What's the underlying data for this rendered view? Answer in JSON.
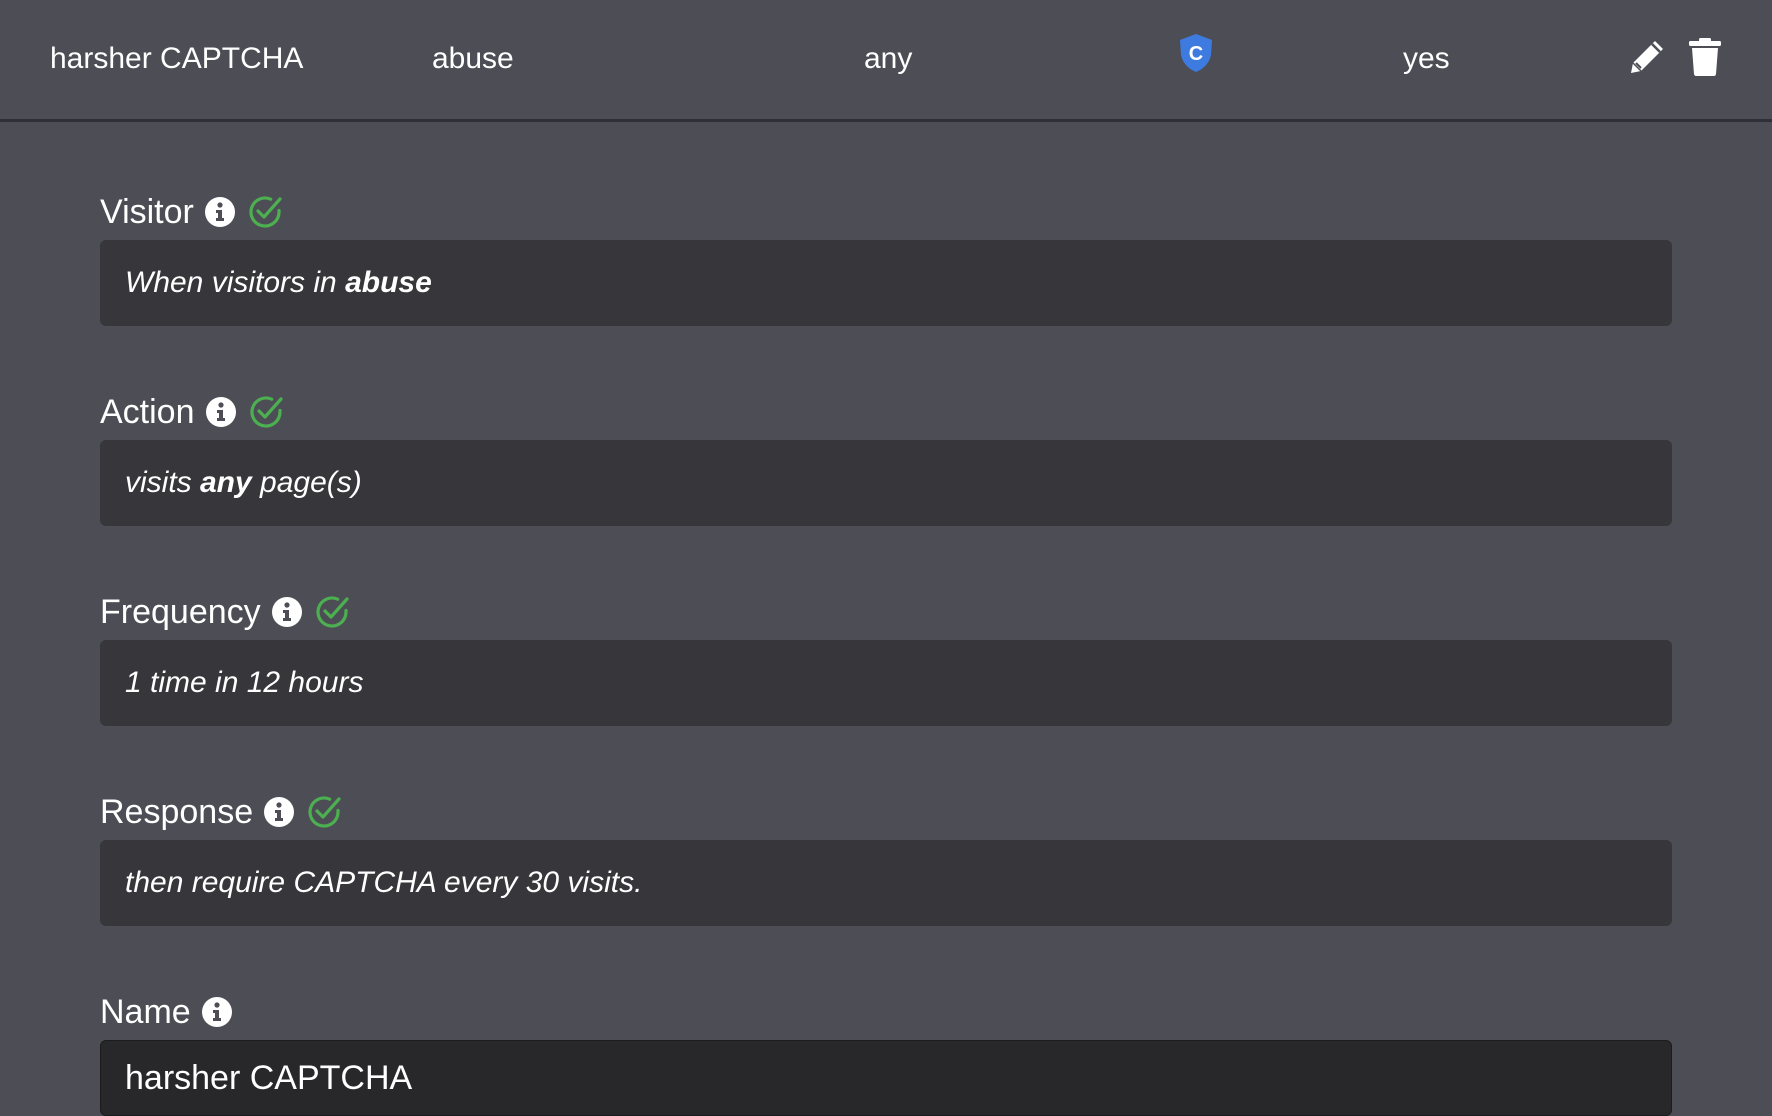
{
  "rule_row": {
    "name": "harsher CAPTCHA",
    "visitor": "abuse",
    "action": "any",
    "response_icon": "captcha-shield-icon",
    "enabled": "yes",
    "edit_icon": "pencil-icon",
    "delete_icon": "trash-icon"
  },
  "fields": {
    "visitor": {
      "label": "Visitor",
      "text_prefix": "When visitors in ",
      "text_bold": "abuse"
    },
    "action": {
      "label": "Action",
      "text_prefix": "visits ",
      "text_bold": "any",
      "text_suffix": " page(s)"
    },
    "frequency": {
      "label": "Frequency",
      "text": "1 time in 12 hours"
    },
    "response": {
      "label": "Response",
      "text": "then require CAPTCHA every 30 visits."
    },
    "name": {
      "label": "Name",
      "value": "harsher CAPTCHA"
    }
  },
  "colors": {
    "background": "#4d4e55",
    "box": "#36363b",
    "check_green": "#4caf50",
    "shield_blue": "#3d7be0"
  }
}
